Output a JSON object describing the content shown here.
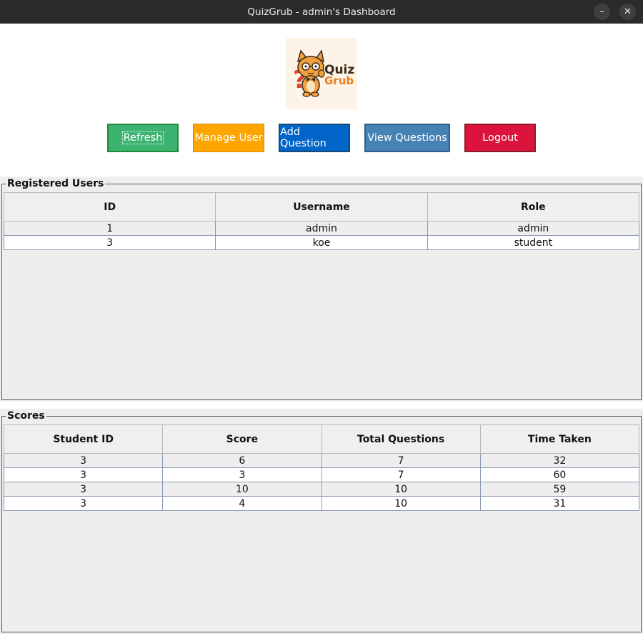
{
  "window": {
    "title": "QuizGrub - admin's Dashboard",
    "minimize_glyph": "–",
    "close_glyph": "✕"
  },
  "logo": {
    "text_line1": "Quiz",
    "text_line2": "Grub",
    "mascot_icon": "cat-mascot-icon"
  },
  "toolbar": {
    "refresh_label": "Refresh",
    "manage_user_label": "Manage User",
    "add_question_label": "Add Question",
    "view_questions_label": "View Questions",
    "logout_label": "Logout"
  },
  "users": {
    "title": "Registered Users",
    "columns": [
      "ID",
      "Username",
      "Role"
    ],
    "rows": [
      [
        "1",
        "admin",
        "admin"
      ],
      [
        "3",
        "koe",
        "student"
      ]
    ]
  },
  "scores": {
    "title": "Scores",
    "columns": [
      "Student ID",
      "Score",
      "Total Questions",
      "Time Taken"
    ],
    "rows": [
      [
        "3",
        "6",
        "7",
        "32"
      ],
      [
        "3",
        "3",
        "7",
        "60"
      ],
      [
        "3",
        "10",
        "10",
        "59"
      ],
      [
        "3",
        "4",
        "10",
        "31"
      ]
    ]
  },
  "colors": {
    "refresh": "#3cb371",
    "manage_user": "#ffa500",
    "add_question": "#0064c8",
    "view_questions": "#4682b4",
    "logout": "#dc143c"
  }
}
